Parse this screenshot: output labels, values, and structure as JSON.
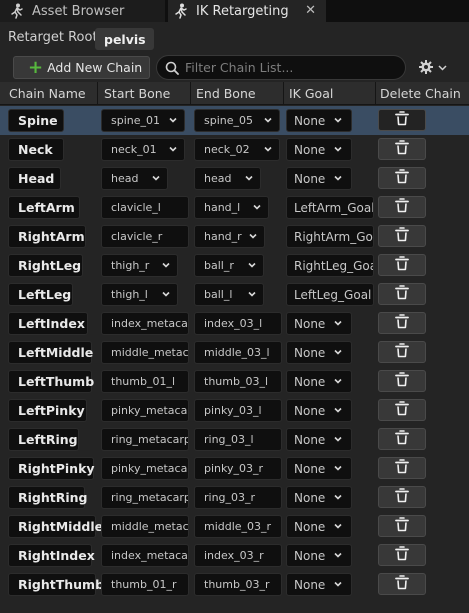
{
  "tabs": [
    {
      "label": "Asset Browser",
      "icon": "skeleton-run-icon"
    },
    {
      "label": "IK Retargeting",
      "icon": "skeleton-run-icon",
      "close": "✕"
    }
  ],
  "retarget_root": {
    "label": "Retarget Root:",
    "value": "pelvis"
  },
  "toolbar": {
    "add_label": "Add New Chain",
    "search_placeholder": "Filter Chain List...",
    "settings_icon": "gear-icon"
  },
  "columns": [
    "Chain Name",
    "Start Bone",
    "End Bone",
    "IK Goal",
    "Delete Chain"
  ],
  "rows": [
    {
      "name": "Spine",
      "start": "spine_01",
      "end": "spine_05",
      "goal": "None",
      "selected": true
    },
    {
      "name": "Neck",
      "start": "neck_01",
      "end": "neck_02",
      "goal": "None"
    },
    {
      "name": "Head",
      "start": "head",
      "end": "head",
      "goal": "None"
    },
    {
      "name": "LeftArm",
      "start": "clavicle_l",
      "end": "hand_l",
      "goal": "LeftArm_Goal"
    },
    {
      "name": "RightArm",
      "start": "clavicle_r",
      "end": "hand_r",
      "goal": "RightArm_Goal"
    },
    {
      "name": "RightLeg",
      "start": "thigh_r",
      "end": "ball_r",
      "goal": "RightLeg_Goal"
    },
    {
      "name": "LeftLeg",
      "start": "thigh_l",
      "end": "ball_l",
      "goal": "LeftLeg_Goal"
    },
    {
      "name": "LeftIndex",
      "start": "index_metacarpal_l",
      "end": "index_03_l",
      "goal": "None"
    },
    {
      "name": "LeftMiddle",
      "start": "middle_metacarpal_l",
      "end": "middle_03_l",
      "goal": "None"
    },
    {
      "name": "LeftThumb",
      "start": "thumb_01_l",
      "end": "thumb_03_l",
      "goal": "None"
    },
    {
      "name": "LeftPinky",
      "start": "pinky_metacarpal_l",
      "end": "pinky_03_l",
      "goal": "None"
    },
    {
      "name": "LeftRing",
      "start": "ring_metacarpal_l",
      "end": "ring_03_l",
      "goal": "None"
    },
    {
      "name": "RightPinky",
      "start": "pinky_metacarpal_r",
      "end": "pinky_03_r",
      "goal": "None"
    },
    {
      "name": "RightRing",
      "start": "ring_metacarpal_r",
      "end": "ring_03_r",
      "goal": "None"
    },
    {
      "name": "RightMiddle",
      "start": "middle_metacarpal_r",
      "end": "middle_03_r",
      "goal": "None"
    },
    {
      "name": "RightIndex",
      "start": "index_metacarpal_r",
      "end": "index_03_r",
      "goal": "None"
    },
    {
      "name": "RightThumb",
      "start": "thumb_01_r",
      "end": "thumb_03_r",
      "goal": "None"
    }
  ],
  "colors": {
    "accent_add": "#57b83e",
    "selected_row": "#3a4d63",
    "panel": "#242424",
    "field": "#0f0f0f"
  }
}
